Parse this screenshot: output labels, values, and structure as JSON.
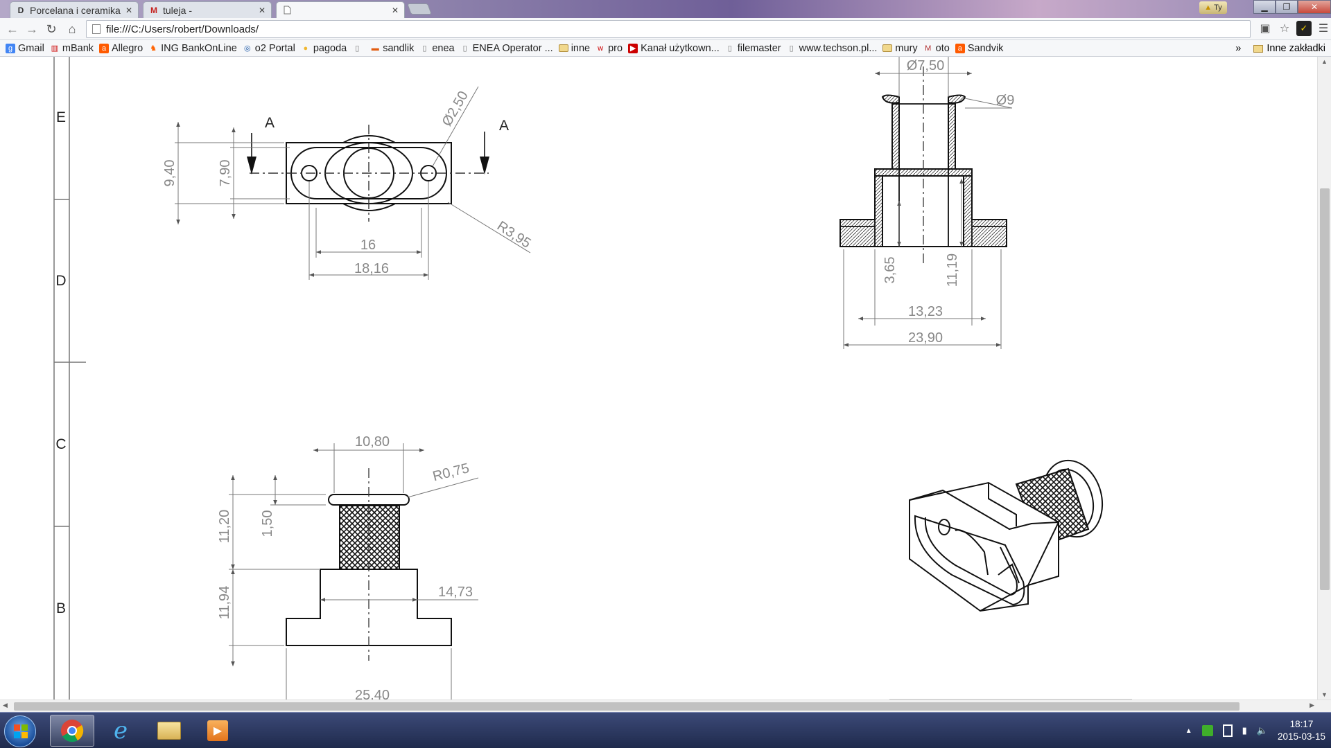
{
  "tabs": [
    {
      "title": "Porcelana i ceramika",
      "favicon": "D"
    },
    {
      "title": "tuleja -",
      "favicon": "M"
    },
    {
      "title": "",
      "favicon": ""
    }
  ],
  "omnibox": {
    "url": "file:///C:/Users/robert/Downloads/"
  },
  "bookmarks": [
    {
      "label": "Gmail",
      "icon": "google-icon"
    },
    {
      "label": "mBank",
      "icon": "bank-icon"
    },
    {
      "label": "Allegro",
      "icon": "allegro-icon"
    },
    {
      "label": "ING BankOnLine",
      "icon": "lion-icon"
    },
    {
      "label": "o2 Portal",
      "icon": "o2-icon"
    },
    {
      "label": "pagoda",
      "icon": "circle-icon"
    },
    {
      "label": "",
      "icon": "page-icon"
    },
    {
      "label": "sandlik",
      "icon": "bar-icon"
    },
    {
      "label": "enea",
      "icon": "page-icon"
    },
    {
      "label": "ENEA Operator ...",
      "icon": "page-icon"
    },
    {
      "label": "inne",
      "icon": "folder-icon"
    },
    {
      "label": "pro",
      "icon": "w-icon"
    },
    {
      "label": "Kanał użytkown...",
      "icon": "youtube-icon"
    },
    {
      "label": "filemaster",
      "icon": "page-icon"
    },
    {
      "label": "www.techson.pl...",
      "icon": "page-icon"
    },
    {
      "label": "mury",
      "icon": "folder-icon"
    },
    {
      "label": "oto",
      "icon": "m-icon"
    },
    {
      "label": "Sandvik",
      "icon": "allegro-icon"
    }
  ],
  "bookmarks_more": "»",
  "bookmarks_other": "Inne zakładki",
  "user_badge": "Ty",
  "drawing": {
    "zones": [
      "E",
      "D",
      "C",
      "B"
    ],
    "section_label": "A",
    "top_view": {
      "d_hole": "Ø2,50",
      "h_outer": "9,40",
      "h_inner": "7,90",
      "radius": "R3,95",
      "w_inner": "16",
      "w_outer": "18,16"
    },
    "section_view": {
      "d_top": "Ø7,50",
      "d_flange": "Ø9",
      "depth_a": "3,65",
      "depth_b": "11,19",
      "w_mid": "13,23",
      "w_base": "23,90"
    },
    "front_view": {
      "w_top": "10,80",
      "radius": "R0,75",
      "h_upper": "11,20",
      "h_lip": "1,50",
      "h_lower": "11,94",
      "w_mid": "14,73",
      "w_base": "25,40"
    }
  },
  "clock": {
    "time": "18:17",
    "date": "2015-03-15"
  }
}
